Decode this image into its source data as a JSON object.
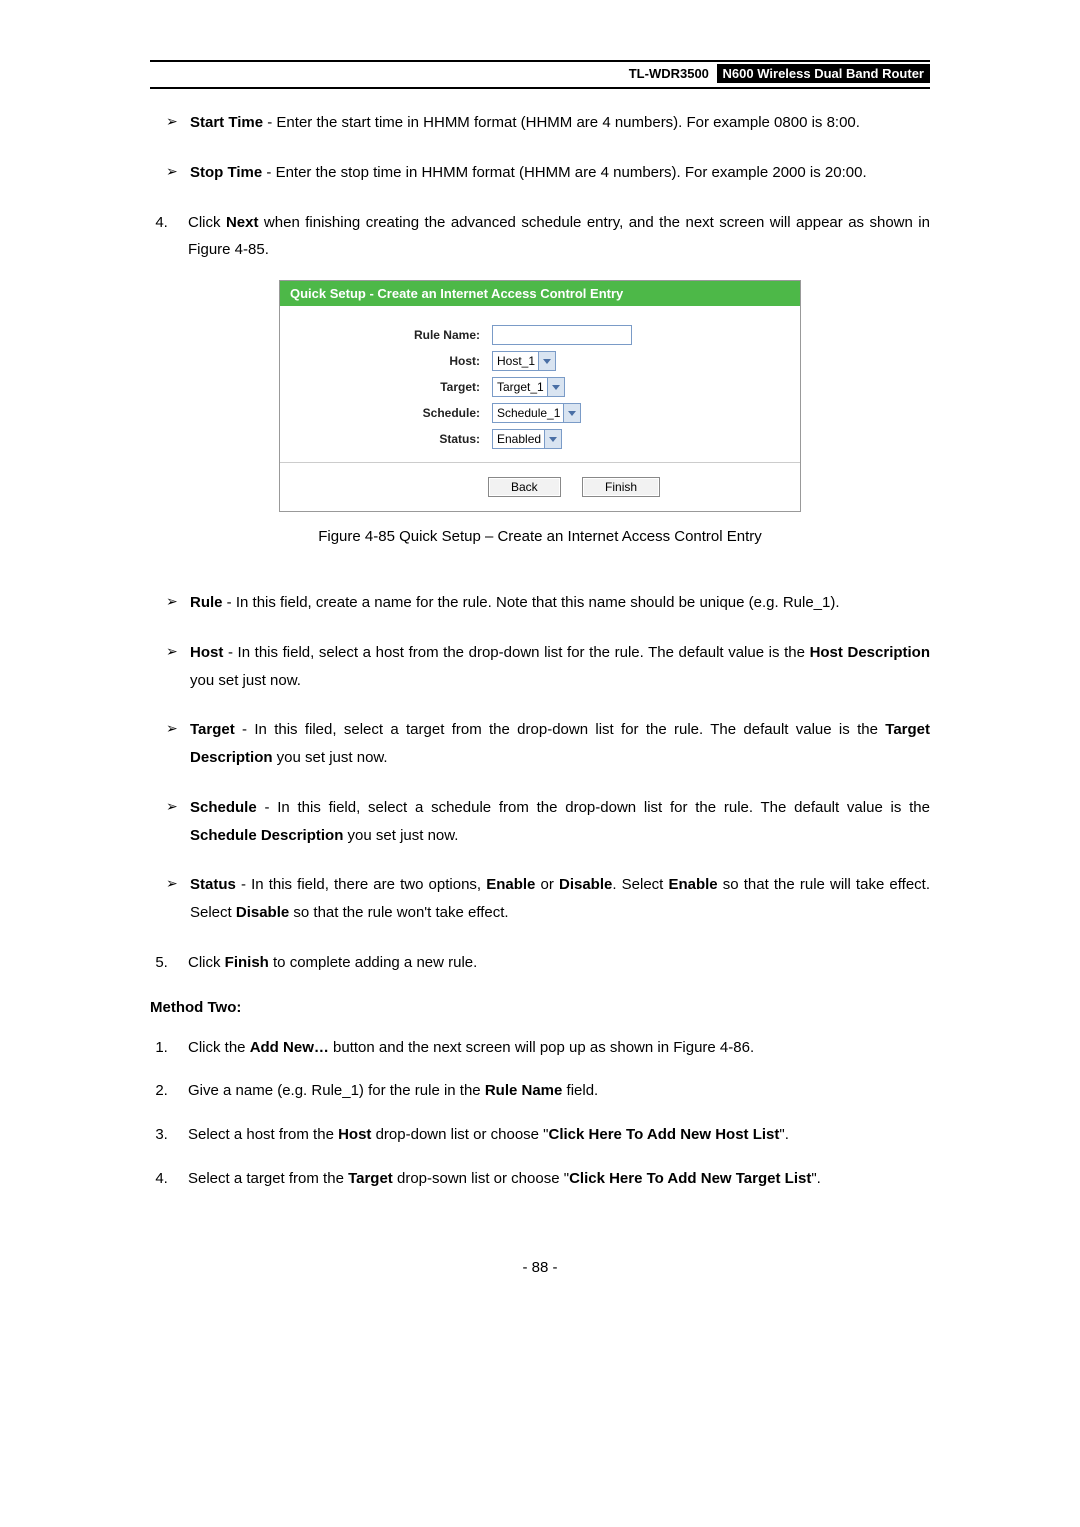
{
  "header": {
    "model": "TL-WDR3500",
    "product_name": "N600 Wireless Dual Band Router"
  },
  "top_bullets": [
    {
      "bold": "Start Time",
      "text": " - Enter the start time in HHMM format (HHMM are 4 numbers). For example 0800 is 8:00."
    },
    {
      "bold": "Stop Time",
      "text": " - Enter the stop time in HHMM format (HHMM are 4 numbers). For example 2000 is 20:00."
    }
  ],
  "step4": {
    "pre": "Click ",
    "bold": "Next",
    "post": " when finishing creating the advanced schedule entry, and the next screen will appear as shown in Figure 4-85."
  },
  "figure": {
    "title": "Quick Setup - Create an Internet Access Control Entry",
    "labels": {
      "rule_name": "Rule Name:",
      "host": "Host:",
      "target": "Target:",
      "schedule": "Schedule:",
      "status": "Status:"
    },
    "values": {
      "rule_name": "",
      "host": "Host_1",
      "target": "Target_1",
      "schedule": "Schedule_1",
      "status": "Enabled"
    },
    "buttons": {
      "back": "Back",
      "finish": "Finish"
    },
    "caption": "Figure 4-85 Quick Setup – Create an Internet Access Control Entry"
  },
  "mid_bullets": {
    "rule": {
      "bold": "Rule",
      "text": " - In this field, create a name for the rule. Note that this name should be unique (e.g. Rule_1)."
    },
    "host": {
      "bold": "Host",
      "t1": " - In this field, select a host from the drop-down list for the rule. The default value is the ",
      "b2": "Host Description",
      "t2": " you set just now."
    },
    "target": {
      "bold": "Target",
      "t1": " - In this filed, select a target from the drop-down list for the rule. The default value is the ",
      "b2": "Target Description",
      "t2": " you set just now."
    },
    "schedule": {
      "bold": "Schedule",
      "t1": " - In this field, select a schedule from the drop-down list for the rule. The default value is the ",
      "b2": "Schedule Description",
      "t2": " you set just now."
    },
    "status": {
      "bold": "Status",
      "t1": " - In this field, there are two options, ",
      "b2": "Enable",
      "t2": " or ",
      "b3": "Disable",
      "t3": ". Select ",
      "b4": "Enable",
      "t4": " so that the rule will take effect. Select ",
      "b5": "Disable",
      "t5": " so that the rule won't take effect."
    }
  },
  "step5": {
    "pre": "Click ",
    "bold": "Finish",
    "post": " to complete adding a new rule."
  },
  "method_two_heading": "Method Two:",
  "method_two": {
    "s1": {
      "t1": "Click the ",
      "b1": "Add New…",
      "t2": " button and the next screen will pop up as shown in Figure 4-86."
    },
    "s2": {
      "t1": "Give a name (e.g. Rule_1) for the rule in the ",
      "b1": "Rule Name",
      "t2": " field."
    },
    "s3": {
      "t1": "Select a host from the ",
      "b1": "Host",
      "t2": " drop-down list or choose \"",
      "b2": "Click Here To Add New Host List",
      "t3": "\"."
    },
    "s4": {
      "t1": "Select a target from the ",
      "b1": "Target",
      "t2": " drop-sown list or choose \"",
      "b2": "Click Here To Add New Target List",
      "t3": "\"."
    }
  },
  "page_number": "- 88 -"
}
